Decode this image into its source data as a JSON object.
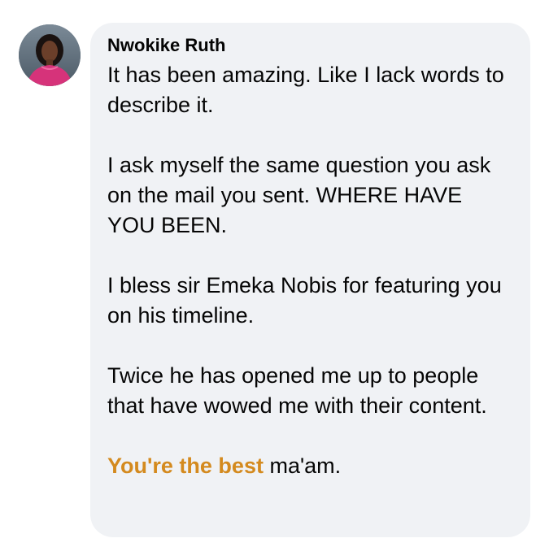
{
  "comment": {
    "author": "Nwokike Ruth",
    "avatar_icon": "profile-photo-avatar",
    "paragraphs": [
      "It has been amazing. Like I lack words to describe it.",
      "I ask myself the same question you ask on the mail you sent. WHERE HAVE YOU BEEN.",
      "I bless sir Emeka Nobis for featuring you on his timeline.",
      "Twice he has opened me up to people that have wowed me with their content."
    ],
    "closing_highlight": "You're the best",
    "closing_rest": " ma'am."
  },
  "colors": {
    "bubble_background": "#f0f2f5",
    "text": "#050505",
    "highlight": "#d48a1e",
    "avatar_outfit": "#d6337a"
  }
}
